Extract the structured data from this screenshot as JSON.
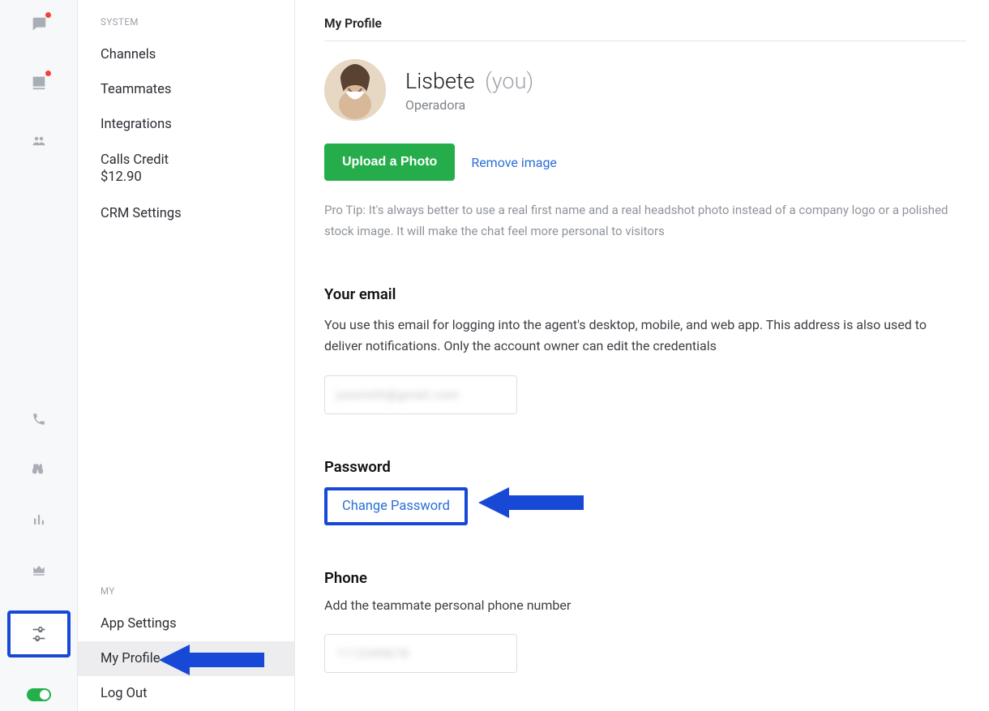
{
  "sidebar": {
    "system_label": "SYSTEM",
    "channels": "Channels",
    "teammates": "Teammates",
    "integrations": "Integrations",
    "calls_credit": "Calls Credit",
    "calls_credit_amount": "$12.90",
    "crm_settings": "CRM Settings",
    "my_label": "MY",
    "app_settings": "App Settings",
    "my_profile": "My Profile",
    "log_out": "Log Out"
  },
  "page": {
    "title": "My Profile"
  },
  "profile": {
    "name": "Lisbete",
    "you_suffix": "(you)",
    "role": "Operadora"
  },
  "photo": {
    "upload_btn": "Upload a Photo",
    "remove_link": "Remove image",
    "tip": "Pro Tip: It's always better to use a real first name and a real headshot photo instead of a company logo or a polished stock image. It will make the chat feel more personal to visitors"
  },
  "email": {
    "heading": "Your email",
    "desc": "You use this email for logging into the agent's desktop, mobile, and web app. This address is also used to deliver notifications. Only the account owner can edit the credentials",
    "value_obscured": "joesmith@gmaiI.com"
  },
  "password": {
    "heading": "Password",
    "change_link": "Change Password"
  },
  "phone": {
    "heading": "Phone",
    "desc": "Add the teammate personal phone number",
    "value_obscured": "1112345678"
  }
}
